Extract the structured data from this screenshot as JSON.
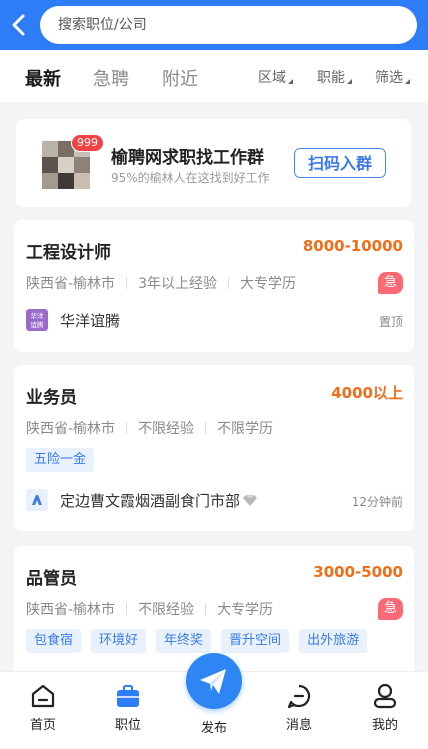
{
  "header": {
    "search_placeholder": "搜索职位/公司"
  },
  "tabs": [
    {
      "label": "最新",
      "active": true
    },
    {
      "label": "急聘",
      "active": false
    },
    {
      "label": "附近",
      "active": false
    }
  ],
  "filters": [
    {
      "label": "区域"
    },
    {
      "label": "职能"
    },
    {
      "label": "筛选"
    }
  ],
  "banner": {
    "badge": "999",
    "title": "榆聘网求职找工作群",
    "subtitle": "95%的榆林人在这找到好工作",
    "button": "扫码入群"
  },
  "jobs": [
    {
      "title": "工程设计师",
      "salary": "8000-10000",
      "location": "陕西省-榆林市",
      "experience": "3年以上经验",
      "education": "大专学历",
      "urgent_badge": "急",
      "tags": [],
      "company": "华洋谊腾",
      "company_logo_text": "华洋谊腾",
      "right_note": "置顶"
    },
    {
      "title": "业务员",
      "salary": "4000以上",
      "location": "陕西省-榆林市",
      "experience": "不限经验",
      "education": "不限学历",
      "urgent_badge": "",
      "tags": [
        "五险一金"
      ],
      "company": "定边曹文霞烟酒副食门市部",
      "company_logo_text": "",
      "right_note": "12分钟前"
    },
    {
      "title": "品管员",
      "salary": "3000-5000",
      "location": "陕西省-榆林市",
      "experience": "不限经验",
      "education": "大专学历",
      "urgent_badge": "急",
      "tags": [
        "包食宿",
        "环境好",
        "年终奖",
        "晋升空间",
        "出外旅游"
      ],
      "company": "",
      "company_logo_text": "",
      "right_note": ""
    }
  ],
  "bottom_nav": [
    {
      "label": "首页",
      "icon": "home-icon"
    },
    {
      "label": "职位",
      "icon": "briefcase-icon"
    },
    {
      "label": "发布",
      "icon": "paper-plane-icon"
    },
    {
      "label": "消息",
      "icon": "message-icon"
    },
    {
      "label": "我的",
      "icon": "user-icon"
    }
  ],
  "colors": {
    "header_blue": "#2e7cf6",
    "salary_orange": "#f06d1a",
    "urgent_red": "#fb6a74",
    "tag_blue": "#3a7be8"
  }
}
